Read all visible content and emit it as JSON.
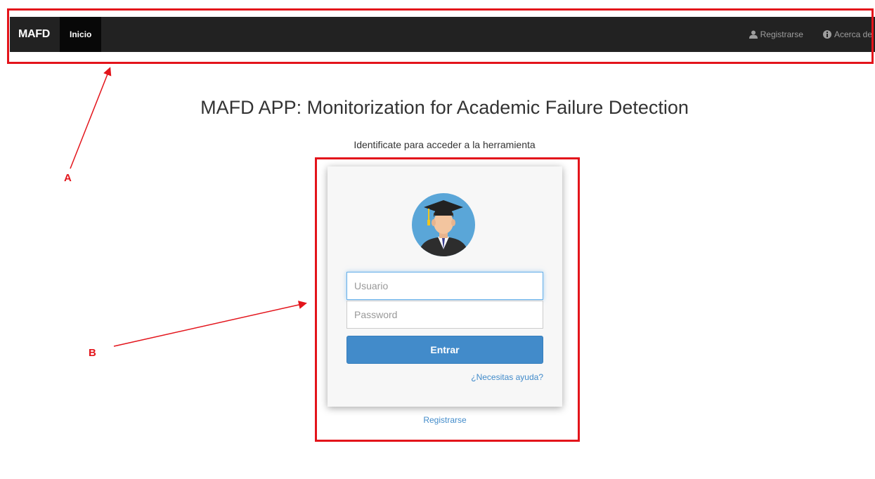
{
  "navbar": {
    "brand": "MAFD",
    "active_item": "Inicio",
    "right_items": [
      {
        "label": "Registrarse",
        "icon": "user-icon"
      },
      {
        "label": "Acerca de",
        "icon": "info-icon"
      }
    ]
  },
  "main": {
    "title": "MAFD APP: Monitorization for Academic Failure Detection",
    "subtitle": "Identificate para acceder a la herramienta"
  },
  "login": {
    "avatar_icon": "graduate-avatar-icon",
    "username_placeholder": "Usuario",
    "password_placeholder": "Password",
    "submit_label": "Entrar",
    "help_link": "¿Necesitas ayuda?",
    "register_link": "Registrarse"
  },
  "annotations": {
    "a_label": "A",
    "b_label": "B",
    "color": "#e3141b"
  },
  "colors": {
    "navbar_bg": "#222222",
    "primary": "#428bca"
  }
}
